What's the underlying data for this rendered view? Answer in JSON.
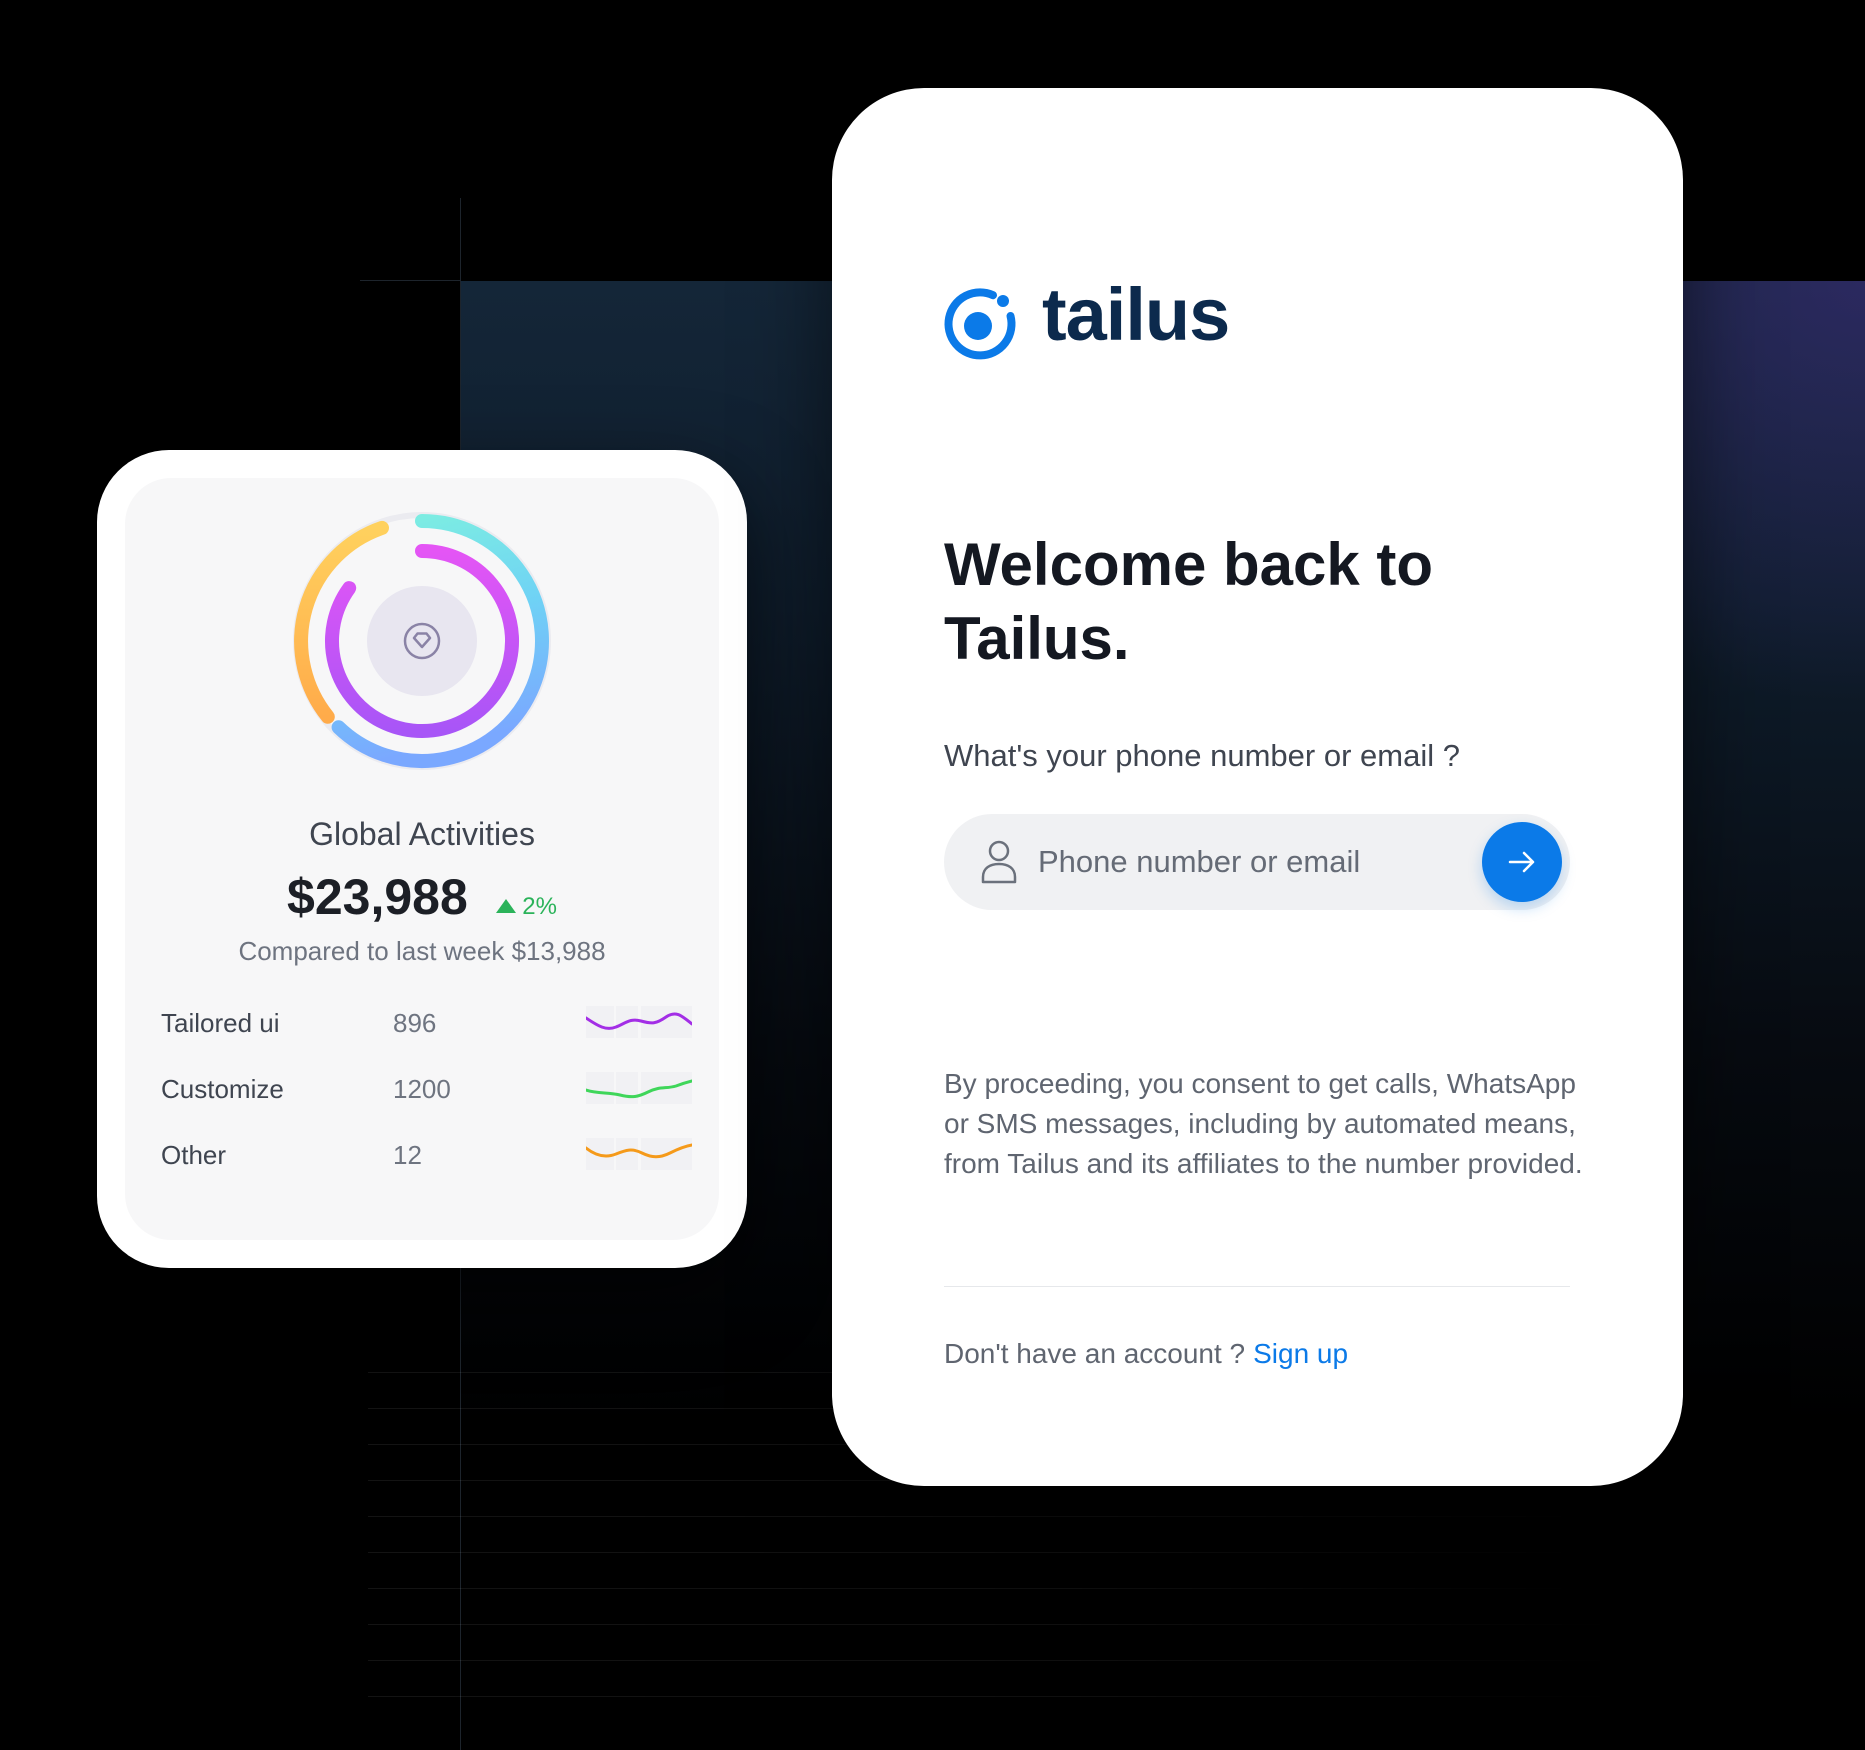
{
  "stats_card": {
    "title": "Global Activities",
    "value": "$23,988",
    "change": "2%",
    "change_direction": "up",
    "compare_text": "Compared to last week $13,988",
    "center_icon": "diamond-icon",
    "rows": [
      {
        "label": "Tailored ui",
        "value": "896",
        "color": "#a32ee6"
      },
      {
        "label": "Customize",
        "value": "1200",
        "color": "#3fd65a"
      },
      {
        "label": "Other",
        "value": "12",
        "color": "#f59a1a"
      }
    ],
    "ring_colors": {
      "outer": [
        "#ffd15e",
        "#ffab4a",
        "#7ef0e0",
        "#6fd2f5",
        "#7aa8ff"
      ],
      "inner": [
        "#e455f5",
        "#a855f7"
      ]
    }
  },
  "login": {
    "brand": "tailus",
    "brand_color": "#0b7ae8",
    "heading": "Welcome back to Tailus.",
    "question": "What's your phone number or email ?",
    "input": {
      "placeholder": "Phone number or email",
      "value": ""
    },
    "submit_icon": "arrow-right-icon",
    "consent": "By proceeding, you consent to get calls, WhatsApp or SMS messages, including by automated means, from Tailus and its affiliates to the number provided.",
    "signup_prompt": "Don't have an account ?",
    "signup_link": "Sign up"
  }
}
